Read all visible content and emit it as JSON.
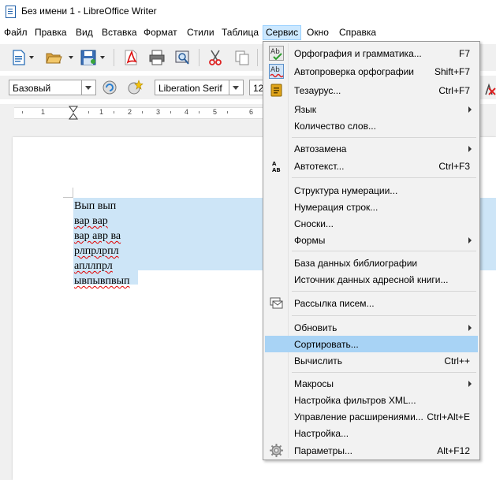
{
  "window": {
    "title": "Без имени 1 - LibreOffice Writer"
  },
  "menubar": {
    "items": [
      {
        "id": "file",
        "label": "Файл"
      },
      {
        "id": "edit",
        "label": "Правка"
      },
      {
        "id": "view",
        "label": "Вид"
      },
      {
        "id": "insert",
        "label": "Вставка"
      },
      {
        "id": "format",
        "label": "Формат"
      },
      {
        "id": "styles",
        "label": "Стили"
      },
      {
        "id": "table",
        "label": "Таблица"
      },
      {
        "id": "tools",
        "label": "Сервис"
      },
      {
        "id": "window",
        "label": "Окно"
      },
      {
        "id": "help",
        "label": "Справка"
      }
    ],
    "active": "Сервис"
  },
  "formatting": {
    "paragraph_style": "Базовый",
    "font_name": "Liberation Serif",
    "font_size": "12"
  },
  "ruler": {
    "labels": [
      "1",
      "1",
      "2",
      "3",
      "4",
      "5",
      "6"
    ]
  },
  "document": {
    "lines": [
      "Вып вып",
      "вар вар",
      "вар авр ва",
      "рлпрлрпл",
      "апллпрл",
      "ывпывпвып"
    ]
  },
  "tools_menu": {
    "items": {
      "spelling": {
        "label": "Орфография и грамматика...",
        "shortcut": "F7",
        "icon": "spellcheck-icon"
      },
      "autospell": {
        "label": "Автопроверка орфографии",
        "shortcut": "Shift+F7",
        "icon": "autospellcheck-icon"
      },
      "thesaurus": {
        "label": "Тезаурус...",
        "shortcut": "Ctrl+F7",
        "icon": "thesaurus-icon"
      },
      "language": {
        "label": "Язык"
      },
      "wordcount": {
        "label": "Количество слов..."
      },
      "autocorrect": {
        "label": "Автозамена"
      },
      "autotext": {
        "label": "Автотекст...",
        "shortcut": "Ctrl+F3",
        "icon": "autotext-icon"
      },
      "outline_numbering": {
        "label": "Структура нумерации..."
      },
      "line_numbering": {
        "label": "Нумерация строк..."
      },
      "footnotes": {
        "label": "Сноски..."
      },
      "forms": {
        "label": "Формы"
      },
      "bibliography": {
        "label": "База данных библиографии"
      },
      "address_source": {
        "label": "Источник данных адресной книги..."
      },
      "mail_merge": {
        "label": "Рассылка писем...",
        "icon": "mail-merge-icon"
      },
      "update": {
        "label": "Обновить"
      },
      "sort": {
        "label": "Сортировать..."
      },
      "calculate": {
        "label": "Вычислить",
        "shortcut": "Ctrl++"
      },
      "macros": {
        "label": "Макросы"
      },
      "xml_filters": {
        "label": "Настройка фильтров XML..."
      },
      "extensions": {
        "label": "Управление расширениями...",
        "shortcut": "Ctrl+Alt+E"
      },
      "customize": {
        "label": "Настройка..."
      },
      "options": {
        "label": "Параметры...",
        "shortcut": "Alt+F12",
        "icon": "options-gear-icon"
      }
    }
  }
}
